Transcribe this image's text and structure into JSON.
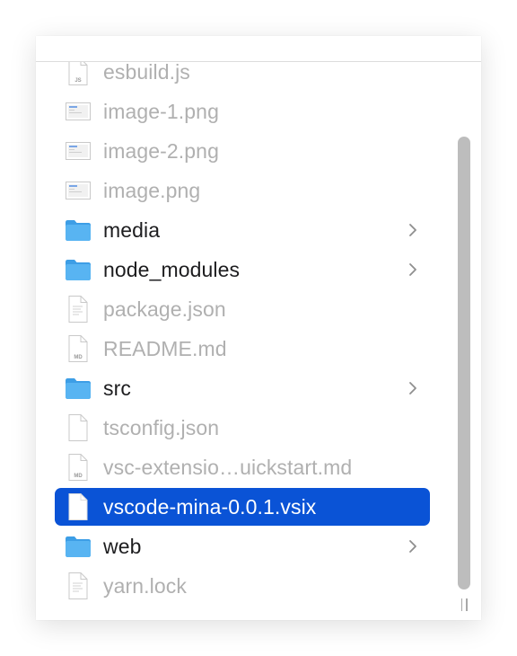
{
  "list": {
    "items": [
      {
        "label": "esbuild.js",
        "kind": "file",
        "icon": "js-file-icon",
        "selected": false,
        "has_children": false
      },
      {
        "label": "image-1.png",
        "kind": "file",
        "icon": "image-file-icon",
        "selected": false,
        "has_children": false
      },
      {
        "label": "image-2.png",
        "kind": "file",
        "icon": "image-file-icon",
        "selected": false,
        "has_children": false
      },
      {
        "label": "image.png",
        "kind": "file",
        "icon": "image-file-icon",
        "selected": false,
        "has_children": false
      },
      {
        "label": "media",
        "kind": "folder",
        "icon": "folder-icon",
        "selected": false,
        "has_children": true
      },
      {
        "label": "node_modules",
        "kind": "folder",
        "icon": "folder-icon",
        "selected": false,
        "has_children": true
      },
      {
        "label": "package.json",
        "kind": "file",
        "icon": "text-file-icon",
        "selected": false,
        "has_children": false
      },
      {
        "label": "README.md",
        "kind": "file",
        "icon": "md-file-icon",
        "selected": false,
        "has_children": false
      },
      {
        "label": "src",
        "kind": "folder",
        "icon": "folder-icon",
        "selected": false,
        "has_children": true
      },
      {
        "label": "tsconfig.json",
        "kind": "file",
        "icon": "document-icon",
        "selected": false,
        "has_children": false
      },
      {
        "label": "vsc-extensio…uickstart.md",
        "kind": "file",
        "icon": "md-file-icon",
        "selected": false,
        "has_children": false
      },
      {
        "label": "vscode-mina-0.0.1.vsix",
        "kind": "file",
        "icon": "document-icon",
        "selected": true,
        "has_children": false
      },
      {
        "label": "web",
        "kind": "folder",
        "icon": "folder-icon",
        "selected": false,
        "has_children": true
      },
      {
        "label": "yarn.lock",
        "kind": "file",
        "icon": "text-file-icon",
        "selected": false,
        "has_children": false
      }
    ]
  },
  "colors": {
    "selection": "#0a53d6",
    "folder": "#58b4f2",
    "dim_text": "#b0b0b0",
    "text": "#1d1d1f"
  }
}
